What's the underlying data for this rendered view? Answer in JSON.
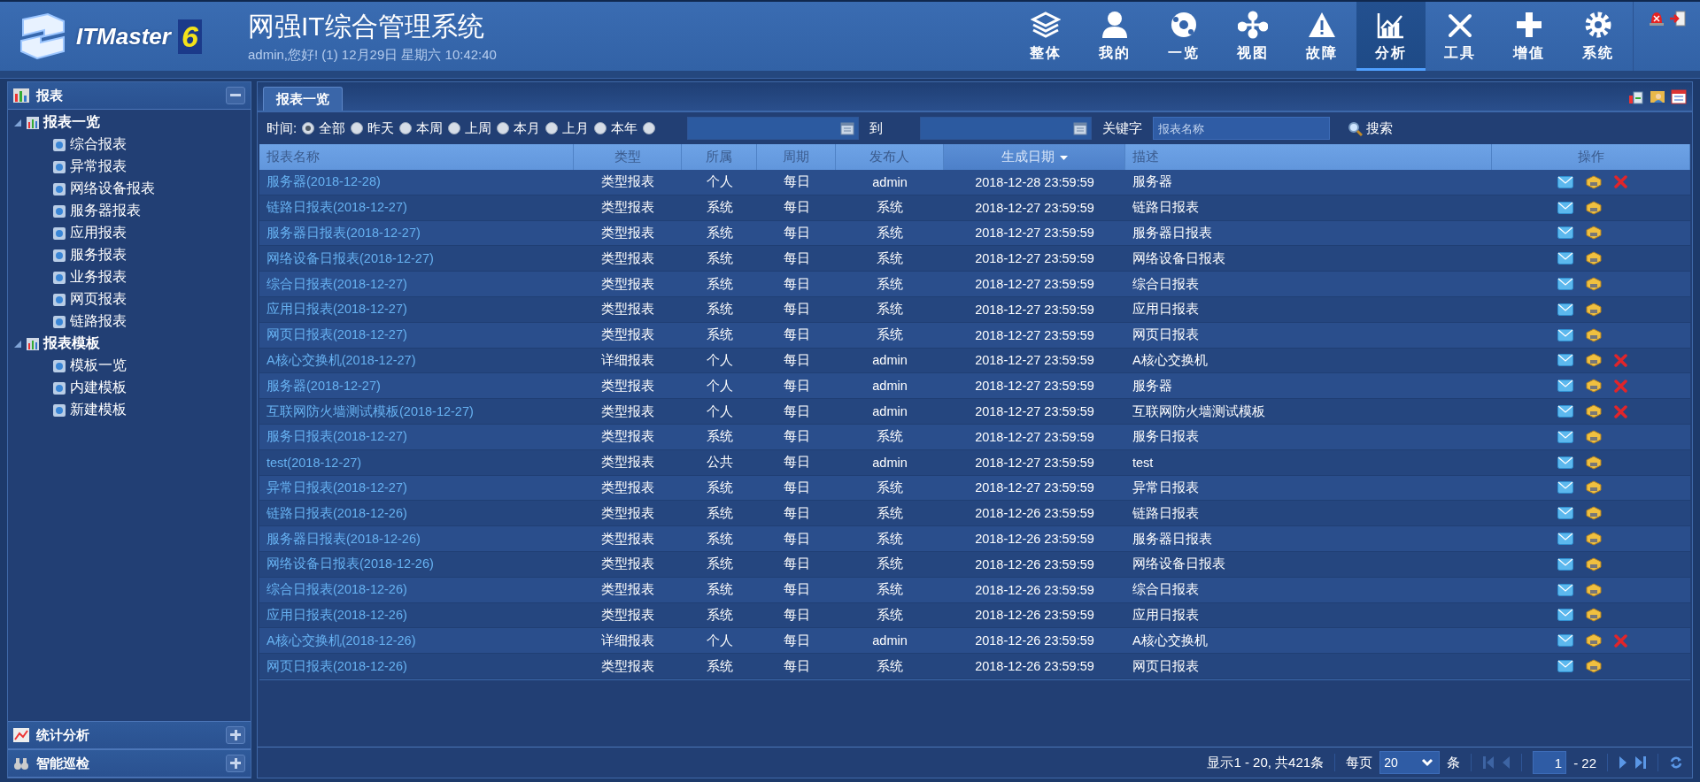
{
  "header": {
    "logo_text": "ITMaster",
    "logo_version": "6",
    "title": "网强IT综合管理系统",
    "greeting": "admin,您好! (1) 12月29日 星期六 10:42:40"
  },
  "nav": [
    {
      "label": "整体",
      "selected": false
    },
    {
      "label": "我的",
      "selected": false
    },
    {
      "label": "一览",
      "selected": false
    },
    {
      "label": "视图",
      "selected": false
    },
    {
      "label": "故障",
      "selected": false
    },
    {
      "label": "分析",
      "selected": true
    },
    {
      "label": "工具",
      "selected": false
    },
    {
      "label": "增值",
      "selected": false
    },
    {
      "label": "系统",
      "selected": false
    }
  ],
  "sidebar": {
    "title": "报表",
    "expanded": true,
    "groups": [
      {
        "label": "报表一览",
        "expanded": true,
        "children": [
          {
            "label": "综合报表"
          },
          {
            "label": "异常报表"
          },
          {
            "label": "网络设备报表"
          },
          {
            "label": "服务器报表"
          },
          {
            "label": "应用报表"
          },
          {
            "label": "服务报表"
          },
          {
            "label": "业务报表"
          },
          {
            "label": "网页报表"
          },
          {
            "label": "链路报表"
          }
        ]
      },
      {
        "label": "报表模板",
        "expanded": true,
        "children": [
          {
            "label": "模板一览"
          },
          {
            "label": "内建模板"
          },
          {
            "label": "新建模板"
          }
        ]
      }
    ],
    "collapsed_panels": [
      {
        "label": "统计分析",
        "expanded": false
      },
      {
        "label": "智能巡检",
        "expanded": false
      }
    ]
  },
  "tabs": [
    {
      "label": "报表一览",
      "selected": true
    }
  ],
  "filter": {
    "time_label": "时间:",
    "options": [
      {
        "label": "全部",
        "selected": true
      },
      {
        "label": "昨天",
        "selected": false
      },
      {
        "label": "本周",
        "selected": false
      },
      {
        "label": "上周",
        "selected": false
      },
      {
        "label": "本月",
        "selected": false
      },
      {
        "label": "上月",
        "selected": false
      },
      {
        "label": "本年",
        "selected": false
      },
      {
        "selected": false
      }
    ],
    "to_label": "到",
    "keyword_label": "关键字",
    "keyword_placeholder": "报表名称",
    "search_button": "搜索"
  },
  "table": {
    "columns": [
      {
        "label": "报表名称",
        "sorted": false
      },
      {
        "label": "类型",
        "sorted": false
      },
      {
        "label": "所属",
        "sorted": false
      },
      {
        "label": "周期",
        "sorted": false
      },
      {
        "label": "发布人",
        "sorted": false
      },
      {
        "label": "生成日期",
        "sorted": true
      },
      {
        "label": "描述",
        "sorted": false
      },
      {
        "label": "操作",
        "sorted": false
      }
    ],
    "rows": [
      {
        "name": "服务器(2018-12-28)",
        "type": "类型报表",
        "owner": "个人",
        "period": "每日",
        "publisher": "admin",
        "date": "2018-12-28 23:59:59",
        "description": "服务器",
        "deletable": true
      },
      {
        "name": "链路日报表(2018-12-27)",
        "type": "类型报表",
        "owner": "系统",
        "period": "每日",
        "publisher": "系统",
        "date": "2018-12-27 23:59:59",
        "description": "链路日报表",
        "deletable": false
      },
      {
        "name": "服务器日报表(2018-12-27)",
        "type": "类型报表",
        "owner": "系统",
        "period": "每日",
        "publisher": "系统",
        "date": "2018-12-27 23:59:59",
        "description": "服务器日报表",
        "deletable": false
      },
      {
        "name": "网络设备日报表(2018-12-27)",
        "type": "类型报表",
        "owner": "系统",
        "period": "每日",
        "publisher": "系统",
        "date": "2018-12-27 23:59:59",
        "description": "网络设备日报表",
        "deletable": false
      },
      {
        "name": "综合日报表(2018-12-27)",
        "type": "类型报表",
        "owner": "系统",
        "period": "每日",
        "publisher": "系统",
        "date": "2018-12-27 23:59:59",
        "description": "综合日报表",
        "deletable": false
      },
      {
        "name": "应用日报表(2018-12-27)",
        "type": "类型报表",
        "owner": "系统",
        "period": "每日",
        "publisher": "系统",
        "date": "2018-12-27 23:59:59",
        "description": "应用日报表",
        "deletable": false
      },
      {
        "name": "网页日报表(2018-12-27)",
        "type": "类型报表",
        "owner": "系统",
        "period": "每日",
        "publisher": "系统",
        "date": "2018-12-27 23:59:59",
        "description": "网页日报表",
        "deletable": false
      },
      {
        "name": "A核心交换机(2018-12-27)",
        "type": "详细报表",
        "owner": "个人",
        "period": "每日",
        "publisher": "admin",
        "date": "2018-12-27 23:59:59",
        "description": "A核心交换机",
        "deletable": true
      },
      {
        "name": "服务器(2018-12-27)",
        "type": "类型报表",
        "owner": "个人",
        "period": "每日",
        "publisher": "admin",
        "date": "2018-12-27 23:59:59",
        "description": "服务器",
        "deletable": true
      },
      {
        "name": "互联网防火墙测试模板(2018-12-27)",
        "type": "类型报表",
        "owner": "个人",
        "period": "每日",
        "publisher": "admin",
        "date": "2018-12-27 23:59:59",
        "description": "互联网防火墙测试模板",
        "deletable": true
      },
      {
        "name": "服务日报表(2018-12-27)",
        "type": "类型报表",
        "owner": "系统",
        "period": "每日",
        "publisher": "系统",
        "date": "2018-12-27 23:59:59",
        "description": "服务日报表",
        "deletable": false
      },
      {
        "name": "test(2018-12-27)",
        "type": "类型报表",
        "owner": "公共",
        "period": "每日",
        "publisher": "admin",
        "date": "2018-12-27 23:59:59",
        "description": "test",
        "deletable": false
      },
      {
        "name": "异常日报表(2018-12-27)",
        "type": "类型报表",
        "owner": "系统",
        "period": "每日",
        "publisher": "系统",
        "date": "2018-12-27 23:59:59",
        "description": "异常日报表",
        "deletable": false
      },
      {
        "name": "链路日报表(2018-12-26)",
        "type": "类型报表",
        "owner": "系统",
        "period": "每日",
        "publisher": "系统",
        "date": "2018-12-26 23:59:59",
        "description": "链路日报表",
        "deletable": false
      },
      {
        "name": "服务器日报表(2018-12-26)",
        "type": "类型报表",
        "owner": "系统",
        "period": "每日",
        "publisher": "系统",
        "date": "2018-12-26 23:59:59",
        "description": "服务器日报表",
        "deletable": false
      },
      {
        "name": "网络设备日报表(2018-12-26)",
        "type": "类型报表",
        "owner": "系统",
        "period": "每日",
        "publisher": "系统",
        "date": "2018-12-26 23:59:59",
        "description": "网络设备日报表",
        "deletable": false
      },
      {
        "name": "综合日报表(2018-12-26)",
        "type": "类型报表",
        "owner": "系统",
        "period": "每日",
        "publisher": "系统",
        "date": "2018-12-26 23:59:59",
        "description": "综合日报表",
        "deletable": false
      },
      {
        "name": "应用日报表(2018-12-26)",
        "type": "类型报表",
        "owner": "系统",
        "period": "每日",
        "publisher": "系统",
        "date": "2018-12-26 23:59:59",
        "description": "应用日报表",
        "deletable": false
      },
      {
        "name": "A核心交换机(2018-12-26)",
        "type": "详细报表",
        "owner": "个人",
        "period": "每日",
        "publisher": "admin",
        "date": "2018-12-26 23:59:59",
        "description": "A核心交换机",
        "deletable": true
      },
      {
        "name": "网页日报表(2018-12-26)",
        "type": "类型报表",
        "owner": "系统",
        "period": "每日",
        "publisher": "系统",
        "date": "2018-12-26 23:59:59",
        "description": "网页日报表",
        "deletable": false
      }
    ]
  },
  "pager": {
    "summary": "显示1 - 20, 共421条",
    "per_page_label": "每页",
    "per_page": "20",
    "per_page_unit": "条",
    "page": "1",
    "page_total": "- 22"
  }
}
